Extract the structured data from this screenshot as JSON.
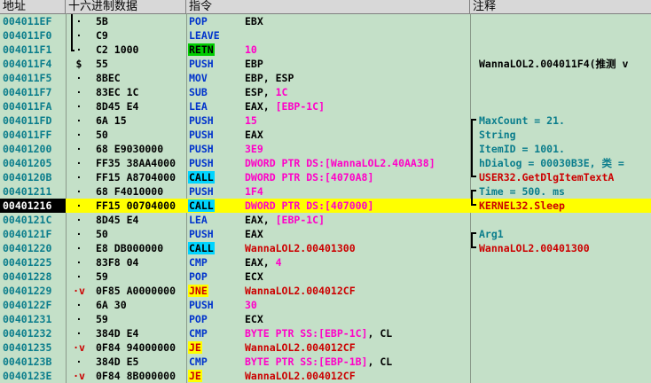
{
  "header": {
    "address": "地址",
    "hex": "十六进制数据",
    "disasm": "指令",
    "comment": "注释"
  },
  "rows": [
    {
      "addr": "004011EF",
      "mark": "·",
      "hex": "5B",
      "mn": "POP",
      "mnc": "blue",
      "op": "EBX",
      "opc": "blk",
      "cm": "",
      "cmc": "black"
    },
    {
      "addr": "004011F0",
      "mark": "·",
      "hex": "C9",
      "mn": "LEAVE",
      "mnc": "blue",
      "op": "",
      "opc": "blk",
      "cm": "",
      "cmc": "black"
    },
    {
      "addr": "004011F1",
      "mark": "·",
      "hex": "C2 1000",
      "mn": "RETN",
      "mnc": "retn",
      "op": "10",
      "opc": "mag",
      "cm": "",
      "cmc": "black"
    },
    {
      "addr": "004011F4",
      "mark": "$",
      "hex": "55",
      "mn": "PUSH",
      "mnc": "blue",
      "op": "EBP",
      "opc": "blk",
      "cm": "WannaLOL2.004011F4(推测 v",
      "cmc": "black"
    },
    {
      "addr": "004011F5",
      "mark": "·",
      "hex": "8BEC",
      "mn": "MOV",
      "mnc": "blue",
      "op": "EBP, ESP",
      "opc": "blk",
      "cm": "",
      "cmc": "black"
    },
    {
      "addr": "004011F7",
      "mark": "·",
      "hex": "83EC 1C",
      "mn": "SUB",
      "mnc": "blue",
      "op": "ESP, 1C",
      "opc": "mix1",
      "cm": "",
      "cmc": "black"
    },
    {
      "addr": "004011FA",
      "mark": "·",
      "hex": "8D45 E4",
      "mn": "LEA",
      "mnc": "blue",
      "op": "EAX, [EBP-1C]",
      "opc": "mix2",
      "cm": "",
      "cmc": "black"
    },
    {
      "addr": "004011FD",
      "mark": "·",
      "hex": "6A 15",
      "mn": "PUSH",
      "mnc": "blue",
      "op": "15",
      "opc": "mag",
      "cm": "MaxCount = 21.",
      "cmc": "teal"
    },
    {
      "addr": "004011FF",
      "mark": "·",
      "hex": "50",
      "mn": "PUSH",
      "mnc": "blue",
      "op": "EAX",
      "opc": "blk",
      "cm": "String",
      "cmc": "teal"
    },
    {
      "addr": "00401200",
      "mark": "·",
      "hex": "68 E9030000",
      "mn": "PUSH",
      "mnc": "blue",
      "op": "3E9",
      "opc": "mag",
      "cm": "ItemID = 1001.",
      "cmc": "teal"
    },
    {
      "addr": "00401205",
      "mark": "·",
      "hex": "FF35 38AA4000",
      "mn": "PUSH",
      "mnc": "blue",
      "op": "DWORD PTR DS:[WannaLOL2.40AA38]",
      "opc": "mag",
      "cm": "hDialog = 00030B3E, 类 =",
      "cmc": "teal"
    },
    {
      "addr": "0040120B",
      "mark": "·",
      "hex": "FF15 A8704000",
      "mn": "CALL",
      "mnc": "call",
      "op": "DWORD PTR DS:[4070A8]",
      "opc": "mag",
      "cm": "USER32.GetDlgItemTextA",
      "cmc": "red"
    },
    {
      "addr": "00401211",
      "mark": "·",
      "hex": "68 F4010000",
      "mn": "PUSH",
      "mnc": "blue",
      "op": "1F4",
      "opc": "mag",
      "cm": "Time = 500. ms",
      "cmc": "teal"
    },
    {
      "addr": "00401216",
      "mark": "·",
      "hex": "FF15 00704000",
      "mn": "CALL",
      "mnc": "call",
      "op": "DWORD PTR DS:[407000]",
      "opc": "mag",
      "cm": "KERNEL32.Sleep",
      "cmc": "red",
      "hi": true
    },
    {
      "addr": "0040121C",
      "mark": "·",
      "hex": "8D45 E4",
      "mn": "LEA",
      "mnc": "blue",
      "op": "EAX, [EBP-1C]",
      "opc": "mix2",
      "cm": "",
      "cmc": "black"
    },
    {
      "addr": "0040121F",
      "mark": "·",
      "hex": "50",
      "mn": "PUSH",
      "mnc": "blue",
      "op": "EAX",
      "opc": "blk",
      "cm": "Arg1",
      "cmc": "teal"
    },
    {
      "addr": "00401220",
      "mark": "·",
      "hex": "E8 DB000000",
      "mn": "CALL",
      "mnc": "call",
      "op": "WannaLOL2.00401300",
      "opc": "red",
      "cm": "WannaLOL2.00401300",
      "cmc": "red"
    },
    {
      "addr": "00401225",
      "mark": "·",
      "hex": "83F8 04",
      "mn": "CMP",
      "mnc": "blue",
      "op": "EAX, 4",
      "opc": "mix1",
      "cm": "",
      "cmc": "black"
    },
    {
      "addr": "00401228",
      "mark": "·",
      "hex": "59",
      "mn": "POP",
      "mnc": "blue",
      "op": "ECX",
      "opc": "blk",
      "cm": "",
      "cmc": "black"
    },
    {
      "addr": "00401229",
      "mark": "·v",
      "hex": "0F85 A0000000",
      "mn": "JNE",
      "mnc": "jcc",
      "op": "WannaLOL2.004012CF",
      "opc": "red",
      "cm": "",
      "cmc": "black"
    },
    {
      "addr": "0040122F",
      "mark": "·",
      "hex": "6A 30",
      "mn": "PUSH",
      "mnc": "blue",
      "op": "30",
      "opc": "mag",
      "cm": "",
      "cmc": "black"
    },
    {
      "addr": "00401231",
      "mark": "·",
      "hex": "59",
      "mn": "POP",
      "mnc": "blue",
      "op": "ECX",
      "opc": "blk",
      "cm": "",
      "cmc": "black"
    },
    {
      "addr": "00401232",
      "mark": "·",
      "hex": "384D E4",
      "mn": "CMP",
      "mnc": "blue",
      "op": "BYTE PTR SS:[EBP-1C], CL",
      "opc": "mix3",
      "cm": "",
      "cmc": "black"
    },
    {
      "addr": "00401235",
      "mark": "·v",
      "hex": "0F84 94000000",
      "mn": "JE",
      "mnc": "jcc",
      "op": "WannaLOL2.004012CF",
      "opc": "red",
      "cm": "",
      "cmc": "black"
    },
    {
      "addr": "0040123B",
      "mark": "·",
      "hex": "384D E5",
      "mn": "CMP",
      "mnc": "blue",
      "op": "BYTE PTR SS:[EBP-1B], CL",
      "opc": "mix4",
      "cm": "",
      "cmc": "black"
    },
    {
      "addr": "0040123E",
      "mark": "·v",
      "hex": "0F84 8B000000",
      "mn": "JE",
      "mnc": "jcc",
      "op": "WannaLOL2.004012CF",
      "opc": "red",
      "cm": "",
      "cmc": "black"
    }
  ],
  "operand_parts": {
    "mix1_a": "ESP, ",
    "mix1_b": "1C",
    "mix2_a": "EAX, ",
    "mix2_b": "[EBP-1C]"
  }
}
